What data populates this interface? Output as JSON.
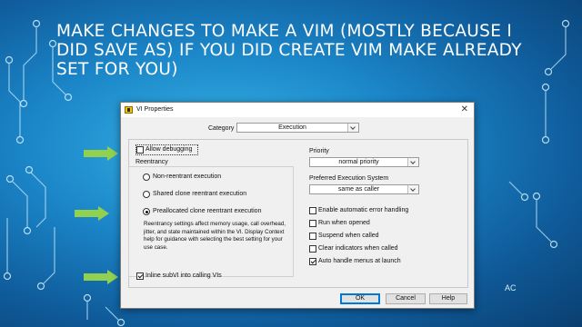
{
  "slide": {
    "title": "Make changes to make a vim (mostly  because I did save as) if you did create vim make already set for you)",
    "footer_mark": "AC",
    "colors": {
      "background": "#1b86c8",
      "arrow": "#92d050",
      "circuit": "#bfe6fa"
    }
  },
  "dialog": {
    "title": "VI Properties",
    "close_icon": "close-icon",
    "category_label": "Category",
    "category_value": "Execution",
    "allow_debugging": {
      "label": "Allow debugging",
      "checked": false
    },
    "reentrancy_label": "Reentrancy",
    "reentrancy_options": [
      {
        "label": "Non-reentrant execution",
        "selected": false
      },
      {
        "label": "Shared clone reentrant execution",
        "selected": false
      },
      {
        "label": "Preallocated clone reentrant execution",
        "selected": true
      }
    ],
    "reentrancy_description": "Reentrancy settings affect memory usage, call overhead, jitter, and state maintained within the VI. Display Context help for guidance with selecting the best setting for your use case.",
    "inline_subvi": {
      "label": "Inline subVI into calling VIs",
      "checked": true
    },
    "priority_label": "Priority",
    "priority_value": "normal priority",
    "exec_system_label": "Preferred Execution System",
    "exec_system_value": "same as caller",
    "options": [
      {
        "label": "Enable automatic error handling",
        "checked": false
      },
      {
        "label": "Run when opened",
        "checked": false
      },
      {
        "label": "Suspend when called",
        "checked": false
      },
      {
        "label": "Clear indicators when called",
        "checked": false
      },
      {
        "label": "Auto handle menus at launch",
        "checked": true
      }
    ],
    "buttons": {
      "ok": "OK",
      "cancel": "Cancel",
      "help": "Help"
    }
  }
}
